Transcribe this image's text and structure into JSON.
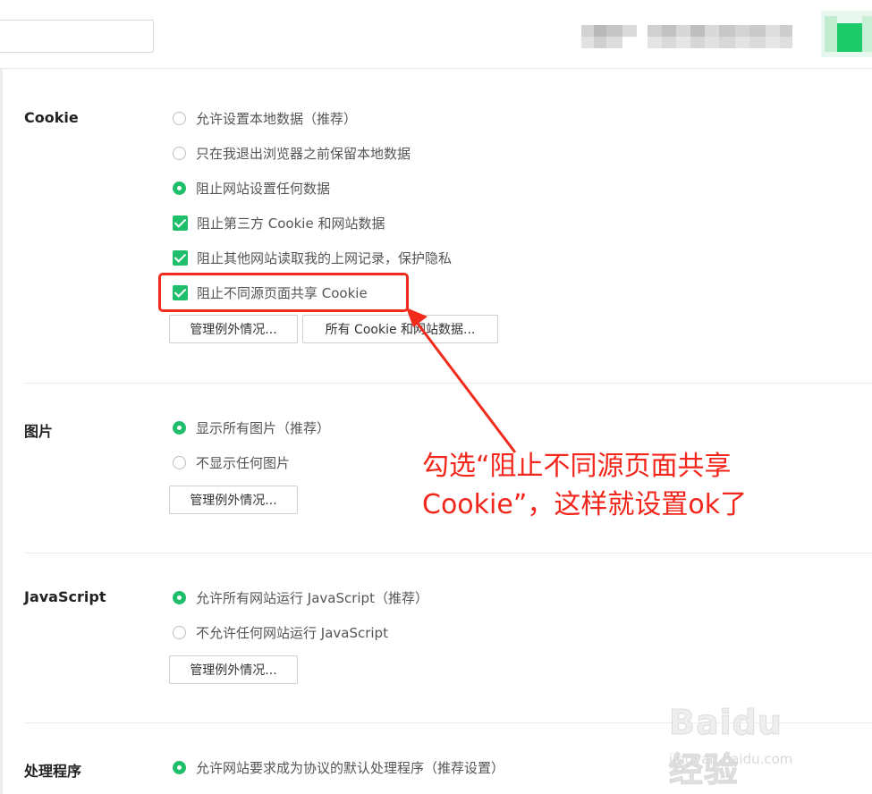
{
  "search": {
    "placeholder": ""
  },
  "cookie": {
    "title": "Cookie",
    "options": [
      "允许设置本地数据（推荐）",
      "只在我退出浏览器之前保留本地数据",
      "阻止网站设置任何数据"
    ],
    "checks": [
      "阻止第三方 Cookie 和网站数据",
      "阻止其他网站读取我的上网记录，保护隐私",
      "阻止不同源页面共享 Cookie"
    ],
    "manage_exceptions_label": "管理例外情况...",
    "all_cookies_label": "所有 Cookie 和网站数据..."
  },
  "images": {
    "title": "图片",
    "options": [
      "显示所有图片（推荐）",
      "不显示任何图片"
    ],
    "manage_exceptions_label": "管理例外情况..."
  },
  "javascript": {
    "title": "JavaScript",
    "options": [
      "允许所有网站运行 JavaScript（推荐）",
      "不允许任何网站运行 JavaScript"
    ],
    "manage_exceptions_label": "管理例外情况..."
  },
  "handlers": {
    "title": "处理程序",
    "options": [
      "允许网站要求成为协议的默认处理程序（推荐设置）"
    ]
  },
  "annotation": {
    "line1": "勾选“阻止不同源页面共享",
    "line2": "Cookie”，这样就设置ok了"
  },
  "watermark": {
    "brand": "Baidu 经验",
    "url": "jingyan.baidu.com"
  },
  "colors": {
    "accent": "#1fbe6a",
    "annotation": "#f2261b"
  }
}
